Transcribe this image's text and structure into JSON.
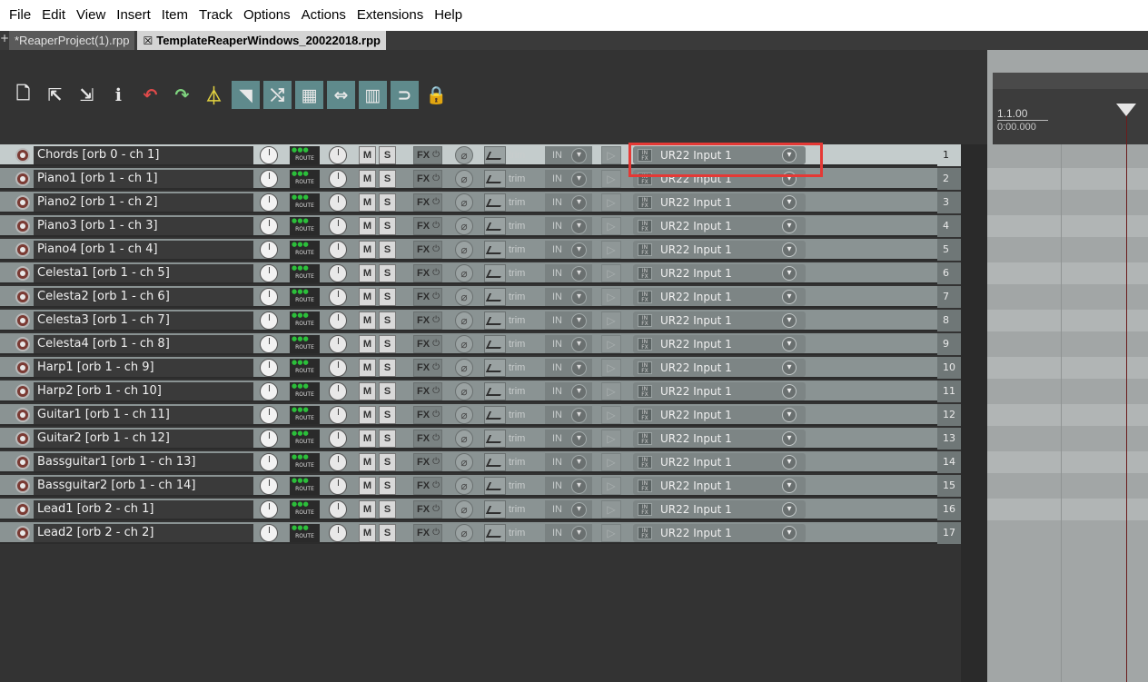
{
  "menu": [
    "File",
    "Edit",
    "View",
    "Insert",
    "Item",
    "Track",
    "Options",
    "Actions",
    "Extensions",
    "Help"
  ],
  "tabs": [
    {
      "label": "*ReaperProject(1).rpp",
      "active": false
    },
    {
      "label": "TemplateReaperWindows_20022018.rpp",
      "active": true,
      "close_glyph": "☒"
    }
  ],
  "tab_add_glyph": "+",
  "toolbar": [
    {
      "icon": "new-project-icon",
      "glyph": "🗋"
    },
    {
      "icon": "open-project-icon",
      "glyph": "⇱"
    },
    {
      "icon": "save-project-icon",
      "glyph": "⇲"
    },
    {
      "icon": "project-settings-icon",
      "glyph": "ℹ"
    },
    {
      "icon": "undo-icon",
      "glyph": "↶",
      "tone": "red"
    },
    {
      "icon": "redo-icon",
      "glyph": "↷",
      "tone": "green"
    },
    {
      "icon": "metronome-icon",
      "glyph": "⏃",
      "tone": "yellow"
    },
    {
      "icon": "auto-crossfade-icon",
      "glyph": "◥",
      "on": true
    },
    {
      "icon": "ripple-edit-icon",
      "glyph": "⤭",
      "on": true
    },
    {
      "icon": "item-grouping-icon",
      "glyph": "▦",
      "on": true
    },
    {
      "icon": "envelope-points-icon",
      "glyph": "⇔",
      "on": true
    },
    {
      "icon": "grid-icon",
      "glyph": "▥",
      "on": true
    },
    {
      "icon": "snap-icon",
      "glyph": "⊃",
      "on": true
    },
    {
      "icon": "lock-icon",
      "glyph": "🔒"
    }
  ],
  "ruler": {
    "position": "1.1.00",
    "time": "0:00.000"
  },
  "track_controls": {
    "route": "ROUTE",
    "mute": "M",
    "solo": "S",
    "fx": "FX",
    "phase": "⌀",
    "trim": "trim",
    "in": "IN",
    "monitor": "▷",
    "fx_input_icon": "IN FX",
    "dropdown": "▾"
  },
  "tracks": [
    {
      "name": "Chords [orb 0 - ch 1]",
      "input": "UR22 Input 1",
      "number": "1",
      "selected": true
    },
    {
      "name": "Piano1 [orb 1 - ch 1]",
      "input": "UR22 Input 1",
      "number": "2"
    },
    {
      "name": "Piano2 [orb 1 - ch 2]",
      "input": "UR22 Input 1",
      "number": "3"
    },
    {
      "name": "Piano3 [orb 1 - ch 3]",
      "input": "UR22 Input 1",
      "number": "4"
    },
    {
      "name": "Piano4 [orb 1 - ch 4]",
      "input": "UR22 Input 1",
      "number": "5"
    },
    {
      "name": "Celesta1 [orb 1 - ch 5]",
      "input": "UR22 Input 1",
      "number": "6"
    },
    {
      "name": "Celesta2 [orb 1 - ch 6]",
      "input": "UR22 Input 1",
      "number": "7"
    },
    {
      "name": "Celesta3 [orb 1 - ch 7]",
      "input": "UR22 Input 1",
      "number": "8"
    },
    {
      "name": "Celesta4 [orb 1 - ch 8]",
      "input": "UR22 Input 1",
      "number": "9"
    },
    {
      "name": "Harp1 [orb 1 - ch 9]",
      "input": "UR22 Input 1",
      "number": "10"
    },
    {
      "name": "Harp2 [orb 1 - ch 10]",
      "input": "UR22 Input 1",
      "number": "11"
    },
    {
      "name": "Guitar1 [orb 1 - ch 11]",
      "input": "UR22 Input 1",
      "number": "12"
    },
    {
      "name": "Guitar2 [orb 1 - ch 12]",
      "input": "UR22 Input 1",
      "number": "13"
    },
    {
      "name": "Bassguitar1 [orb 1 - ch 13]",
      "input": "UR22 Input 1",
      "number": "14"
    },
    {
      "name": "Bassguitar2 [orb 1 - ch 14]",
      "input": "UR22 Input 1",
      "number": "15"
    },
    {
      "name": "Lead1 [orb 2 - ch 1]",
      "input": "UR22 Input 1",
      "number": "16"
    },
    {
      "name": "Lead2 [orb 2 - ch 2]",
      "input": "UR22 Input 1",
      "number": "17"
    }
  ],
  "colors": {
    "highlight": "#e53935",
    "track_bg": "#8a9393",
    "track_selected_bg": "#c4cccc",
    "route_led": "#2bbf3a",
    "playhead": "#6b1d1d"
  }
}
